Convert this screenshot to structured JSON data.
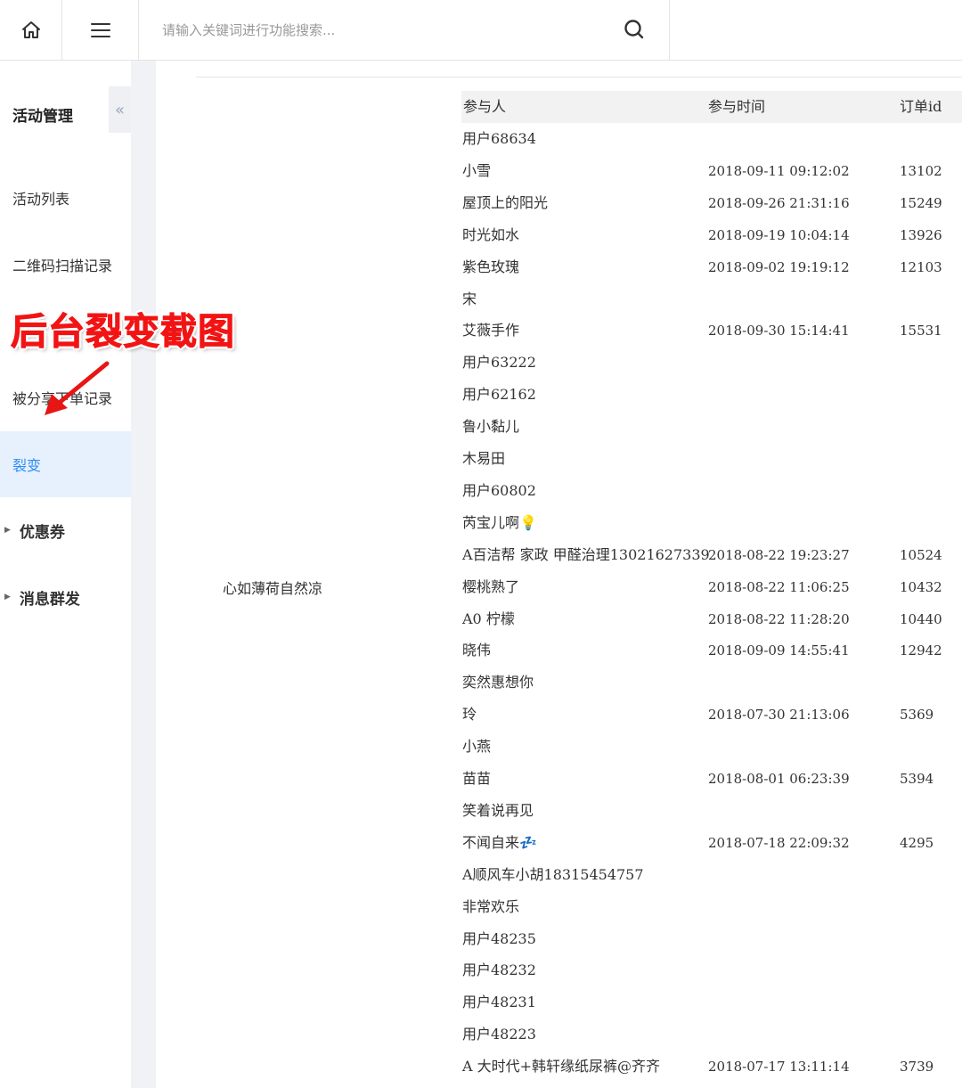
{
  "header": {
    "search_placeholder": "请输入关键词进行功能搜索..."
  },
  "sidebar": {
    "title": "活动管理",
    "collapse_glyph": "«",
    "items": [
      {
        "label": "活动列表"
      },
      {
        "label": "二维码扫描记录"
      },
      {
        "label": "被分享下单记录"
      },
      {
        "label": "裂变"
      }
    ],
    "groups": [
      {
        "label": "优惠券"
      },
      {
        "label": "消息群发"
      }
    ]
  },
  "annotation": {
    "caption": "后台裂变截图",
    "color": "#f21414"
  },
  "main": {
    "activity_name": "心如薄荷自然凉",
    "columns": [
      "参与人",
      "参与时间",
      "订单id"
    ],
    "rows": [
      {
        "name": "用户68634",
        "time": "",
        "order_id": ""
      },
      {
        "name": "小雪",
        "time": "2018-09-11 09:12:02",
        "order_id": "13102"
      },
      {
        "name": "屋顶上的阳光",
        "time": "2018-09-26 21:31:16",
        "order_id": "15249"
      },
      {
        "name": "时光如水",
        "time": "2018-09-19 10:04:14",
        "order_id": "13926"
      },
      {
        "name": "紫色玫瑰",
        "time": "2018-09-02 19:19:12",
        "order_id": "12103"
      },
      {
        "name": "宋",
        "time": "",
        "order_id": ""
      },
      {
        "name": "艾薇手作",
        "time": "2018-09-30 15:14:41",
        "order_id": "15531"
      },
      {
        "name": "用户63222",
        "time": "",
        "order_id": ""
      },
      {
        "name": "用户62162",
        "time": "",
        "order_id": ""
      },
      {
        "name": "鲁小黏儿",
        "time": "",
        "order_id": ""
      },
      {
        "name": "木易田",
        "time": "",
        "order_id": ""
      },
      {
        "name": "用户60802",
        "time": "",
        "order_id": ""
      },
      {
        "name": "芮宝儿啊💡",
        "time": "",
        "order_id": ""
      },
      {
        "name": "A百洁帮 家政 甲醛治理13021627339",
        "time": "2018-08-22 19:23:27",
        "order_id": "10524"
      },
      {
        "name": "樱桃熟了",
        "time": "2018-08-22 11:06:25",
        "order_id": "10432"
      },
      {
        "name": "A0 柠檬",
        "time": "2018-08-22 11:28:20",
        "order_id": "10440"
      },
      {
        "name": "晓伟",
        "time": "2018-09-09 14:55:41",
        "order_id": "12942"
      },
      {
        "name": "奕然惠想你",
        "time": "",
        "order_id": ""
      },
      {
        "name": "玲",
        "time": "2018-07-30 21:13:06",
        "order_id": "5369"
      },
      {
        "name": "小燕",
        "time": "",
        "order_id": ""
      },
      {
        "name": "苗苗",
        "time": "2018-08-01 06:23:39",
        "order_id": "5394"
      },
      {
        "name": "笑着说再见",
        "time": "",
        "order_id": ""
      },
      {
        "name": " 不闻自来💤",
        "time": "2018-07-18 22:09:32",
        "order_id": "4295"
      },
      {
        "name": "A顺风车小胡18315454757",
        "time": "",
        "order_id": ""
      },
      {
        "name": "非常欢乐",
        "time": "",
        "order_id": ""
      },
      {
        "name": "用户48235",
        "time": "",
        "order_id": ""
      },
      {
        "name": "用户48232",
        "time": "",
        "order_id": ""
      },
      {
        "name": "用户48231",
        "time": "",
        "order_id": ""
      },
      {
        "name": "用户48223",
        "time": "",
        "order_id": ""
      },
      {
        "name": "A 大时代+韩轩缘纸尿裤@齐齐",
        "time": "2018-07-17 13:11:14",
        "order_id": "3739"
      }
    ]
  }
}
